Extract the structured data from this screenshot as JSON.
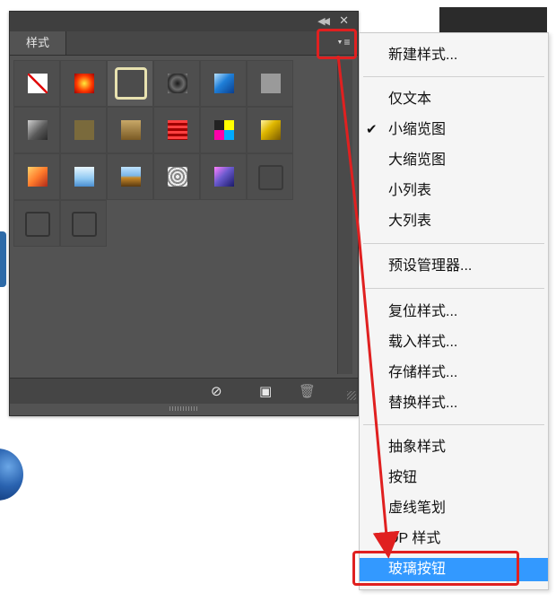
{
  "panel": {
    "tab_label": "样式",
    "collapse_icon": "double-chevron-left-icon",
    "close_icon": "close-icon",
    "menu_icon": "panel-menu-icon",
    "bottom_icons": [
      "clear-style-icon",
      "new-style-icon",
      "delete-trash-icon"
    ]
  },
  "swatches": [
    {
      "name": "none-style",
      "kind": "none"
    },
    {
      "name": "red-glow",
      "bg": "radial-gradient(circle,#ffeb3b 0%,#ff3b00 55%,#a10000 100%)"
    },
    {
      "name": "beveled-outline",
      "bg": "#4c4c4c",
      "border": "#e8e2b0"
    },
    {
      "name": "dark-ring",
      "bg": "radial-gradient(circle,#1a1a1a 0%,#6b6b6b 45%,#2b2b2b 70%,#8a8a8a 100%)"
    },
    {
      "name": "blue-glass",
      "bg": "linear-gradient(135deg,#b8e2ff 0%,#1f7fd8 45%,#0a3f8f 100%)"
    },
    {
      "name": "gray-flat",
      "bg": "#9a9a9a"
    },
    {
      "name": "steel-gradient",
      "bg": "linear-gradient(135deg,#cfcfcf 0%,#5a5a5a 55%,#2a2a2a 100%)"
    },
    {
      "name": "olive-texture",
      "bg": "#7a6a3c"
    },
    {
      "name": "brass",
      "bg": "linear-gradient(180deg,#c8a868 0%,#7a5a24 100%)"
    },
    {
      "name": "red-stripes",
      "bg": "repeating-linear-gradient(180deg,#ff4040 0 3px,#a00000 3px 6px)"
    },
    {
      "name": "rainbow-mosaic",
      "bg": "conic-gradient(#ff0 0 25%,#0af 25% 50%,#f0a 50% 75%,#222 75%)"
    },
    {
      "name": "gold-bevel",
      "bg": "linear-gradient(135deg,#fff3a0 0%,#e0b800 40%,#7a5a00 100%)"
    },
    {
      "name": "sunset-orange",
      "bg": "linear-gradient(135deg,#ffd36b 0%,#ff7a2b 50%,#b02a1a 100%)"
    },
    {
      "name": "sky-blue",
      "bg": "linear-gradient(180deg,#e8f6ff 0%,#8fc8f2 60%,#4a8ed0 100%)"
    },
    {
      "name": "landscape",
      "bg": "linear-gradient(180deg,#bfe3ff 0%,#7ab6e8 45%,#c88a2a 55%,#5a3a10 100%)"
    },
    {
      "name": "crackle-texture",
      "bg": "repeating-radial-gradient(circle,#eee 0 2px,#888 2px 4px)"
    },
    {
      "name": "purple-blue",
      "bg": "linear-gradient(135deg,#ff80ff 0%,#6a5acd 45%,#1a1a6a 100%)"
    },
    {
      "name": "dark-shadow",
      "bg": "#4a4a4a",
      "border": "#3a3a3a"
    },
    {
      "name": "outline-1",
      "bg": "#4f4f4f",
      "border": "#333333"
    },
    {
      "name": "outline-2",
      "bg": "#4f4f4f",
      "border": "#333333"
    }
  ],
  "menu": {
    "items": [
      {
        "label": "新建样式...",
        "checked": false
      },
      {
        "label": "仅文本",
        "checked": false
      },
      {
        "label": "小缩览图",
        "checked": true
      },
      {
        "label": "大缩览图",
        "checked": false
      },
      {
        "label": "小列表",
        "checked": false
      },
      {
        "label": "大列表",
        "checked": false
      },
      {
        "label": "预设管理器...",
        "checked": false
      },
      {
        "label": "复位样式...",
        "checked": false
      },
      {
        "label": "载入样式...",
        "checked": false
      },
      {
        "label": "存储样式...",
        "checked": false
      },
      {
        "label": "替换样式...",
        "checked": false
      },
      {
        "label": "抽象样式",
        "checked": false
      },
      {
        "label": "按钮",
        "checked": false
      },
      {
        "label": "虚线笔划",
        "checked": false
      },
      {
        "label": "DP 样式",
        "checked": false
      },
      {
        "label": "玻璃按钮",
        "checked": false,
        "selected": true
      }
    ],
    "check_glyph": "✔"
  },
  "colors": {
    "highlight": "#3399ff",
    "annotation": "#e02020"
  }
}
